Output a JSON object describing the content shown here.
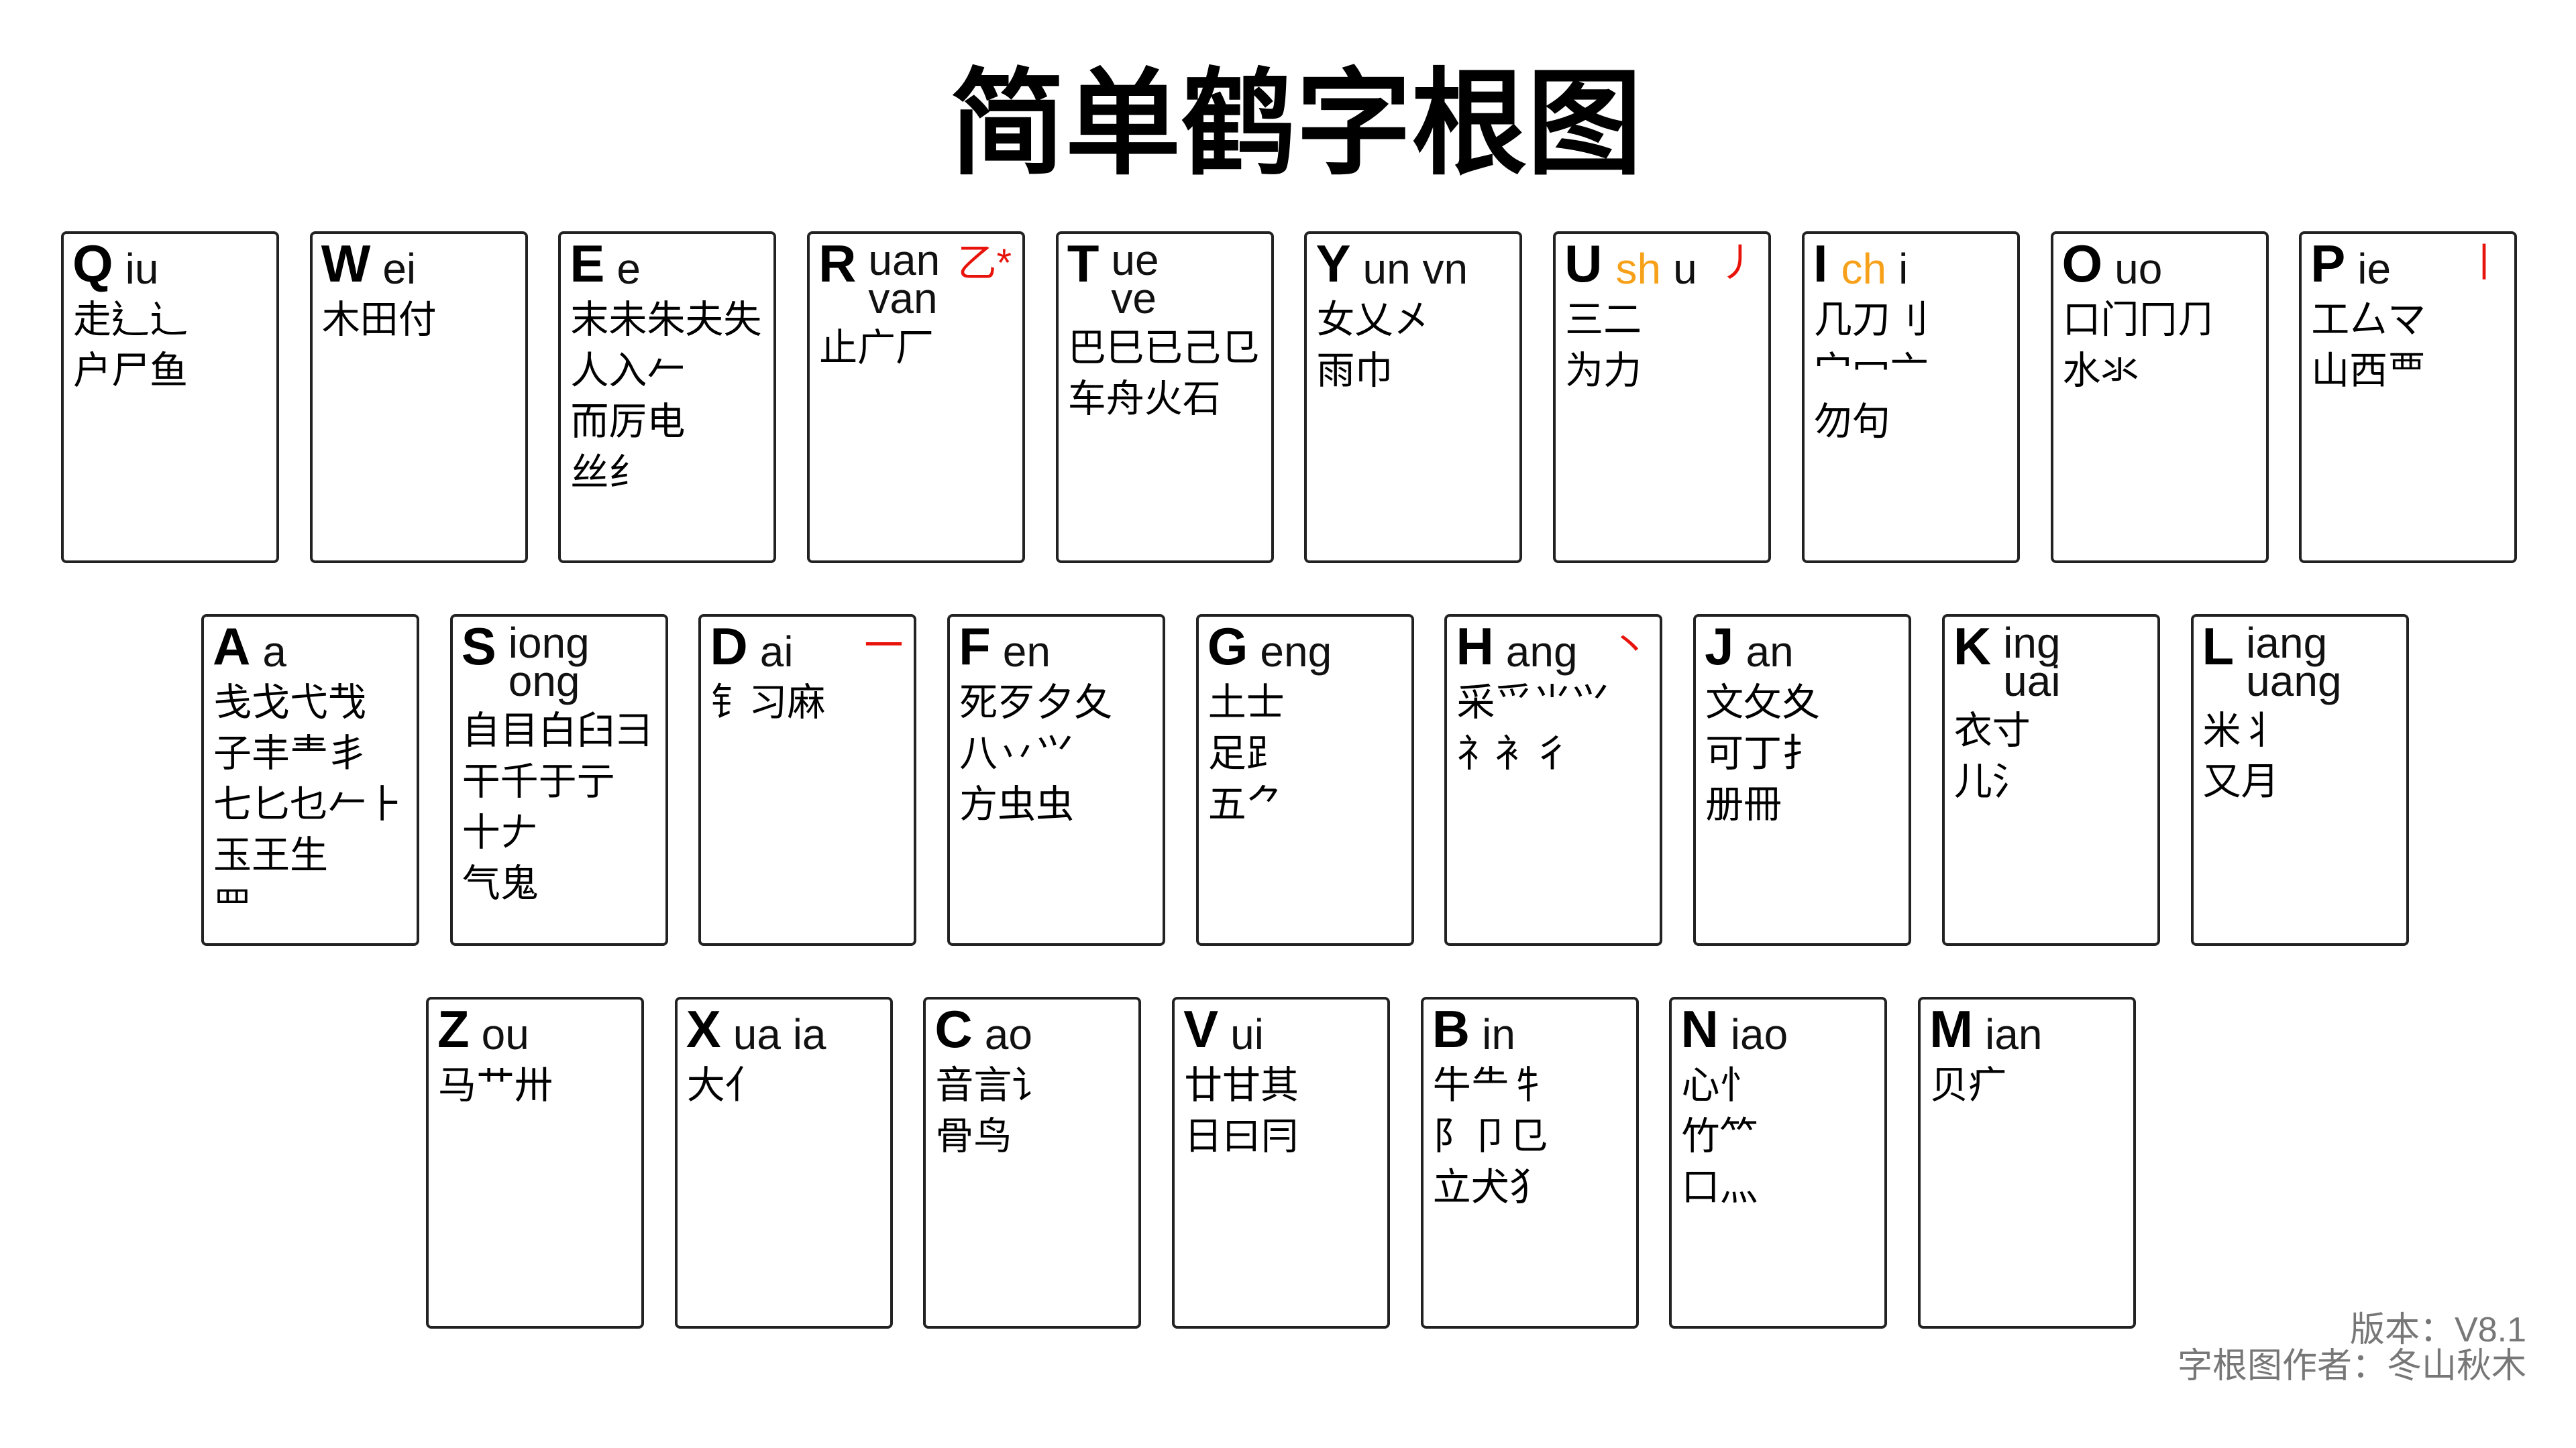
{
  "title": "简单鹤字根图",
  "colors": {
    "stroke": "#e8140c",
    "initial": "#f7a11a",
    "footer": "#777777"
  },
  "rows": [
    {
      "keys": [
        {
          "letter": "Q",
          "finals": [
            "iu"
          ],
          "roots": [
            "走⻎辶",
            "户尸鱼"
          ]
        },
        {
          "letter": "W",
          "finals": [
            "ei"
          ],
          "roots": [
            "木田付"
          ]
        },
        {
          "letter": "E",
          "finals": [
            "e"
          ],
          "roots": [
            "末未朱夫失",
            "人入𠂉",
            "而厉电",
            "丝纟"
          ]
        },
        {
          "letter": "R",
          "finals": [
            "uan",
            "van"
          ],
          "stroke": "乙*",
          "roots": [
            "止广厂"
          ]
        },
        {
          "letter": "T",
          "finals": [
            "ue",
            "ve"
          ],
          "roots": [
            "巴巳已己㔾",
            "车舟火石"
          ]
        },
        {
          "letter": "Y",
          "finals": [
            "un vn"
          ],
          "roots": [
            "女乂㐅",
            "雨巾"
          ]
        },
        {
          "letter": "U",
          "initial": "sh",
          "finals": [
            "u"
          ],
          "stroke": "丿",
          "roots": [
            "三二",
            "为力"
          ]
        },
        {
          "letter": "I",
          "initial": "ch",
          "finals": [
            "i"
          ],
          "roots": [
            "几刀刂",
            "宀冖亠",
            "勿句"
          ]
        },
        {
          "letter": "O",
          "finals": [
            "uo"
          ],
          "roots": [
            "口门冂⺆",
            "水氺"
          ]
        },
        {
          "letter": "P",
          "finals": [
            "ie"
          ],
          "stroke": "丨",
          "roots": [
            "工厶マ",
            "山西覀"
          ]
        }
      ]
    },
    {
      "keys": [
        {
          "letter": "A",
          "finals": [
            "a"
          ],
          "roots": [
            "戋戈弋𢦏",
            "子丰龶丯",
            "七匕乜𠂉⺊",
            "玉王生",
            "罒"
          ]
        },
        {
          "letter": "S",
          "finals": [
            "iong",
            "ong"
          ],
          "roots": [
            "自目白臼彐",
            "干千于亍",
            "十𠂇",
            "气鬼"
          ]
        },
        {
          "letter": "D",
          "finals": [
            "ai"
          ],
          "stroke": "一",
          "roots": [
            "钅习麻"
          ]
        },
        {
          "letter": "F",
          "finals": [
            "en"
          ],
          "roots": [
            "死歹夕夂",
            "八丷⺍",
            "方虫虫"
          ]
        },
        {
          "letter": "G",
          "finals": [
            "eng"
          ],
          "roots": [
            "土士",
            "足⻊",
            "五⺈"
          ]
        },
        {
          "letter": "H",
          "finals": [
            "ang"
          ],
          "stroke": "丶",
          "roots": [
            "采爫⺌⺍",
            "礻衤彳"
          ]
        },
        {
          "letter": "J",
          "finals": [
            "an"
          ],
          "roots": [
            "文攵夊",
            "可丁扌",
            "册冊"
          ]
        },
        {
          "letter": "K",
          "finals": [
            "ing",
            "uai"
          ],
          "roots": [
            "衣寸",
            "儿氵"
          ]
        },
        {
          "letter": "L",
          "finals": [
            "iang",
            "uang"
          ],
          "roots": [
            "米丬",
            "又月"
          ]
        }
      ]
    },
    {
      "keys": [
        {
          "letter": "Z",
          "finals": [
            "ou"
          ],
          "roots": [
            "马艹卅"
          ]
        },
        {
          "letter": "X",
          "finals": [
            "ua ia"
          ],
          "roots": [
            "大亻"
          ]
        },
        {
          "letter": "C",
          "finals": [
            "ao"
          ],
          "roots": [
            "音言讠",
            "骨鸟"
          ]
        },
        {
          "letter": "V",
          "finals": [
            "ui"
          ],
          "roots": [
            "廿甘其",
            "日曰冃"
          ]
        },
        {
          "letter": "B",
          "finals": [
            "in"
          ],
          "roots": [
            "牛⺧牜",
            "阝卩⺋",
            "立犬犭"
          ]
        },
        {
          "letter": "N",
          "finals": [
            "iao"
          ],
          "roots": [
            "心忄",
            "竹⺮",
            "口灬"
          ]
        },
        {
          "letter": "M",
          "finals": [
            "ian"
          ],
          "roots": [
            "贝疒"
          ]
        }
      ]
    }
  ],
  "footer": {
    "version": "版本：V8.1",
    "author": "字根图作者：冬山秋木"
  }
}
